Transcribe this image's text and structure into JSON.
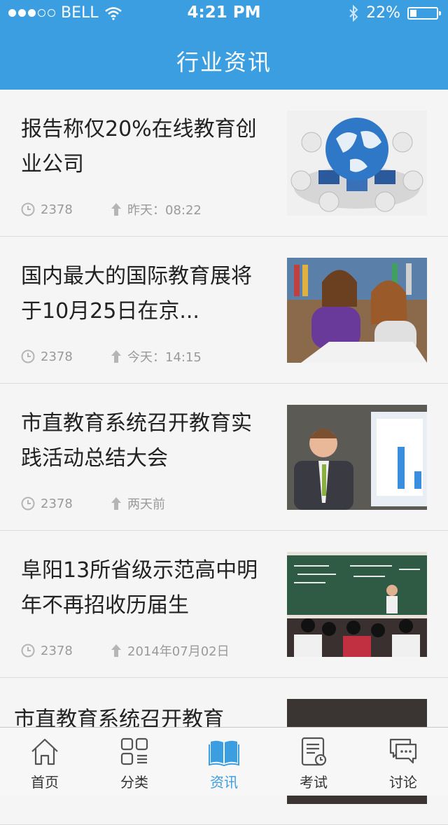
{
  "status": {
    "carrier": "BELL",
    "time": "4:21 PM",
    "battery": "22%",
    "battery_level": 0.22
  },
  "header": {
    "title": "行业资讯"
  },
  "articles": [
    {
      "title": "报告称仅20%在线教育创业公司",
      "views": "2378",
      "date": "昨天：08:22",
      "thumb": "globe-network-image"
    },
    {
      "title": "国内最大的国际教育展将于10月25日在京...",
      "views": "2378",
      "date": "今天：14:15",
      "thumb": "students-studying-image"
    },
    {
      "title": "市直教育系统召开教育实践活动总结大会",
      "views": "2378",
      "date": "两天前",
      "thumb": "presenter-chart-image"
    },
    {
      "title": "阜阳13所省级示范高中明年不再招收历届生",
      "views": "2378",
      "date": "2014年07月02日",
      "thumb": "classroom-image"
    },
    {
      "title": "市直教育系统召开教育",
      "views": "",
      "date": "",
      "thumb": "partial-image"
    }
  ],
  "tabs": [
    {
      "label": "首页",
      "icon": "home-icon"
    },
    {
      "label": "分类",
      "icon": "grid-icon"
    },
    {
      "label": "资讯",
      "icon": "book-icon",
      "active": true
    },
    {
      "label": "考试",
      "icon": "exam-icon"
    },
    {
      "label": "讨论",
      "icon": "chat-icon"
    }
  ],
  "colors": {
    "accent": "#3b9ee0",
    "text": "#222222",
    "meta": "#9a9a9a"
  }
}
